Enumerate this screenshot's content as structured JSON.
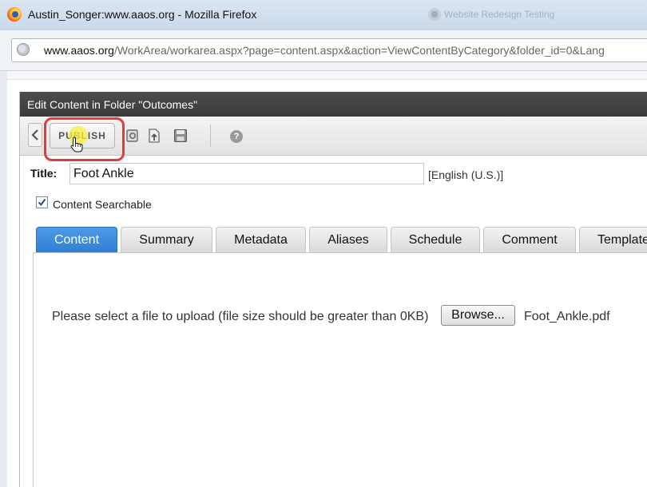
{
  "window": {
    "title": "Austin_Songer:www.aaos.org - Mozilla Firefox",
    "background_tab": "Website Redesign Testing"
  },
  "browser": {
    "url_domain": "www.aaos.org",
    "url_path": "/WorkArea/workarea.aspx?page=content.aspx&action=ViewContentByCategory&folder_id=0&Lang"
  },
  "dialog": {
    "title": "Edit Content in Folder \"Outcomes\"",
    "toolbar": {
      "publish_label": "PUBLISH",
      "help_symbol": "?"
    },
    "form": {
      "title_label": "Title:",
      "title_value": "Foot Ankle",
      "language": "[English (U.S.)]",
      "searchable_label": "Content Searchable",
      "searchable_checked": true
    },
    "tabs": [
      {
        "label": "Content",
        "active": true
      },
      {
        "label": "Summary",
        "active": false
      },
      {
        "label": "Metadata",
        "active": false
      },
      {
        "label": "Aliases",
        "active": false
      },
      {
        "label": "Schedule",
        "active": false
      },
      {
        "label": "Comment",
        "active": false
      },
      {
        "label": "Templates",
        "active": false
      }
    ],
    "upload": {
      "instructions": "Please select a file to upload (file size should be greater than 0KB)",
      "browse_label": "Browse...",
      "file_name": "Foot_Ankle.pdf"
    }
  },
  "icons": [
    "firefox-logo",
    "globe-icon",
    "back-arrow-icon",
    "hand-cursor-icon",
    "view-icon",
    "upload-icon",
    "save-icon",
    "help-icon",
    "checkbox-check-icon"
  ],
  "colors": {
    "active_tab": "#2f7fd6",
    "dialog_header": "#3f3f3f",
    "highlight_frame": "#e23b3b"
  }
}
